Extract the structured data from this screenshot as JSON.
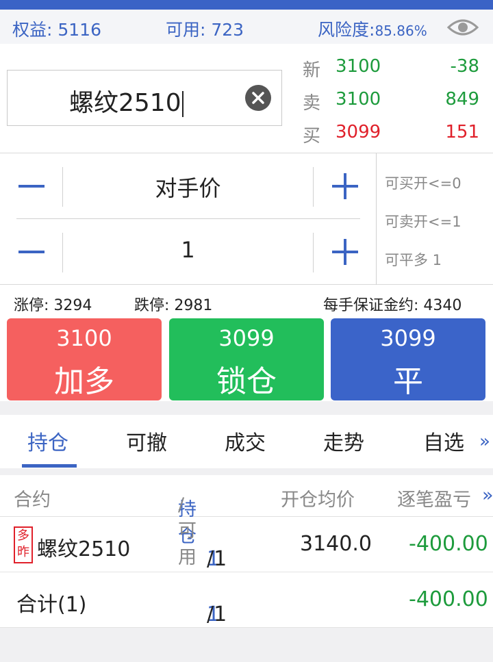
{
  "account": {
    "equity": "权益: 5116",
    "available": "可用: 723",
    "risk_label": "风险度:",
    "risk_value": "85.86%"
  },
  "symbol": "螺纹2510",
  "quotes": [
    {
      "label": "新",
      "price": "3100",
      "vol": "-38",
      "price_color": "green",
      "vol_color": "green"
    },
    {
      "label": "卖",
      "price": "3100",
      "vol": "849",
      "price_color": "green",
      "vol_color": "green"
    },
    {
      "label": "买",
      "price": "3099",
      "vol": "151",
      "price_color": "red",
      "vol_color": "red"
    }
  ],
  "order": {
    "price_type": "对手价",
    "quantity": "1",
    "limits": [
      "可买开<=0",
      "可卖开<=1",
      "可平多 1"
    ]
  },
  "stops": {
    "limit_up": "涨停: 3294",
    "limit_down": "跌停: 2981",
    "margin": "每手保证金约: 4340"
  },
  "actions": [
    {
      "price": "3100",
      "label": "加多",
      "color": "#f5605f"
    },
    {
      "price": "3099",
      "label": "锁仓",
      "color": "#22be5b"
    },
    {
      "price": "3099",
      "label": "平",
      "color": "#3b64c9"
    }
  ],
  "tabs": [
    "持仓",
    "可撤",
    "成交",
    "走势",
    "自选"
  ],
  "more_glyph": "»",
  "table": {
    "headers": {
      "contract": "合约",
      "position": "持仓",
      "available": "/可用",
      "avg_price": "开仓均价",
      "pnl": "逐笔盈亏",
      "more": "»"
    },
    "rows": [
      {
        "badge_top": "多",
        "badge_bottom": "昨",
        "contract": "螺纹2510",
        "pos": "1",
        "avail": "/1",
        "avg_price": "3140.0",
        "pnl": "-400.00"
      }
    ],
    "total": {
      "label": "合计(1)",
      "pos": "1",
      "avail": "/1",
      "pnl": "-400.00"
    }
  },
  "colors": {
    "accent": "#3b64c3",
    "up": "#e0202a",
    "down": "#1d9b3c"
  }
}
